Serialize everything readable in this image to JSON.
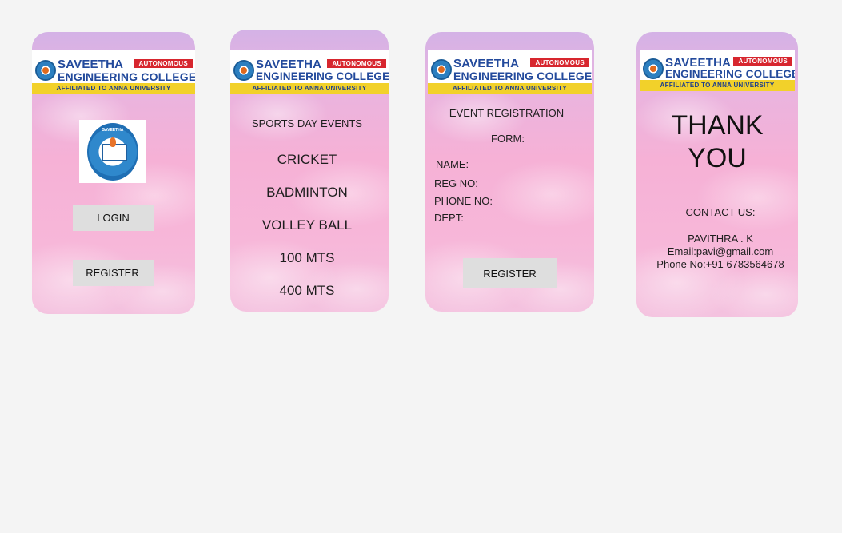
{
  "banner": {
    "line1": "SAVEETHA",
    "line2": "ENGINEERING COLLEGE",
    "badge": "AUTONOMOUS",
    "affiliation": "AFFILIATED TO ANNA UNIVERSITY"
  },
  "screen1": {
    "logo_text": "SAVEETHA",
    "login_label": "LOGIN",
    "register_label": "REGISTER"
  },
  "screen2": {
    "heading": "SPORTS DAY EVENTS",
    "events": [
      "CRICKET",
      "BADMINTON",
      "VOLLEY BALL",
      "100 MTS",
      "400 MTS"
    ]
  },
  "screen3": {
    "heading_line1": "EVENT REGISTRATION",
    "heading_line2": "FORM:",
    "fields": [
      "NAME:",
      "REG NO:",
      "PHONE NO:",
      "DEPT:"
    ],
    "register_label": "REGISTER"
  },
  "screen4": {
    "thank_line1": "THANK",
    "thank_line2": "YOU",
    "contact_heading": "CONTACT US:",
    "contact_name": "PAVITHRA . K",
    "contact_email": "Email:pavi@gmail.com",
    "contact_phone": "Phone No:+91 6783564678"
  }
}
